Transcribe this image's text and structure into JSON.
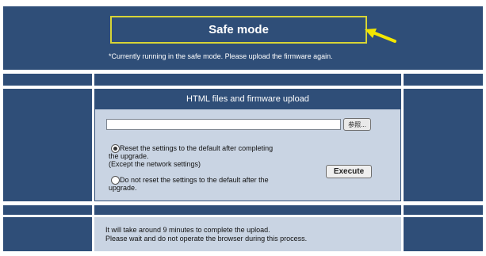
{
  "header": {
    "title": "Safe mode",
    "message": "*Currently running in the safe mode. Please upload the firmware again."
  },
  "upload": {
    "section_title": "HTML files and firmware upload",
    "file_value": "",
    "browse_label": "参照...",
    "options": [
      {
        "line1": "Reset the settings to the default after completing",
        "line2": "the upgrade.",
        "line3": "(Except the network settings)",
        "selected": true
      },
      {
        "line1": "Do not reset the settings to the default after the",
        "line2": "upgrade.",
        "selected": false
      }
    ],
    "execute_label": "Execute"
  },
  "notice": {
    "line1": "It will take around 9 minutes to complete the upload.",
    "line2": "Please wait and do not operate the browser during this process."
  },
  "colors": {
    "panel_navy": "#2f4e78",
    "panel_light": "#c9d4e3",
    "highlight_border": "#d7d436",
    "arrow": "#f2e600"
  },
  "icons": {
    "annotation": "arrow-icon"
  }
}
